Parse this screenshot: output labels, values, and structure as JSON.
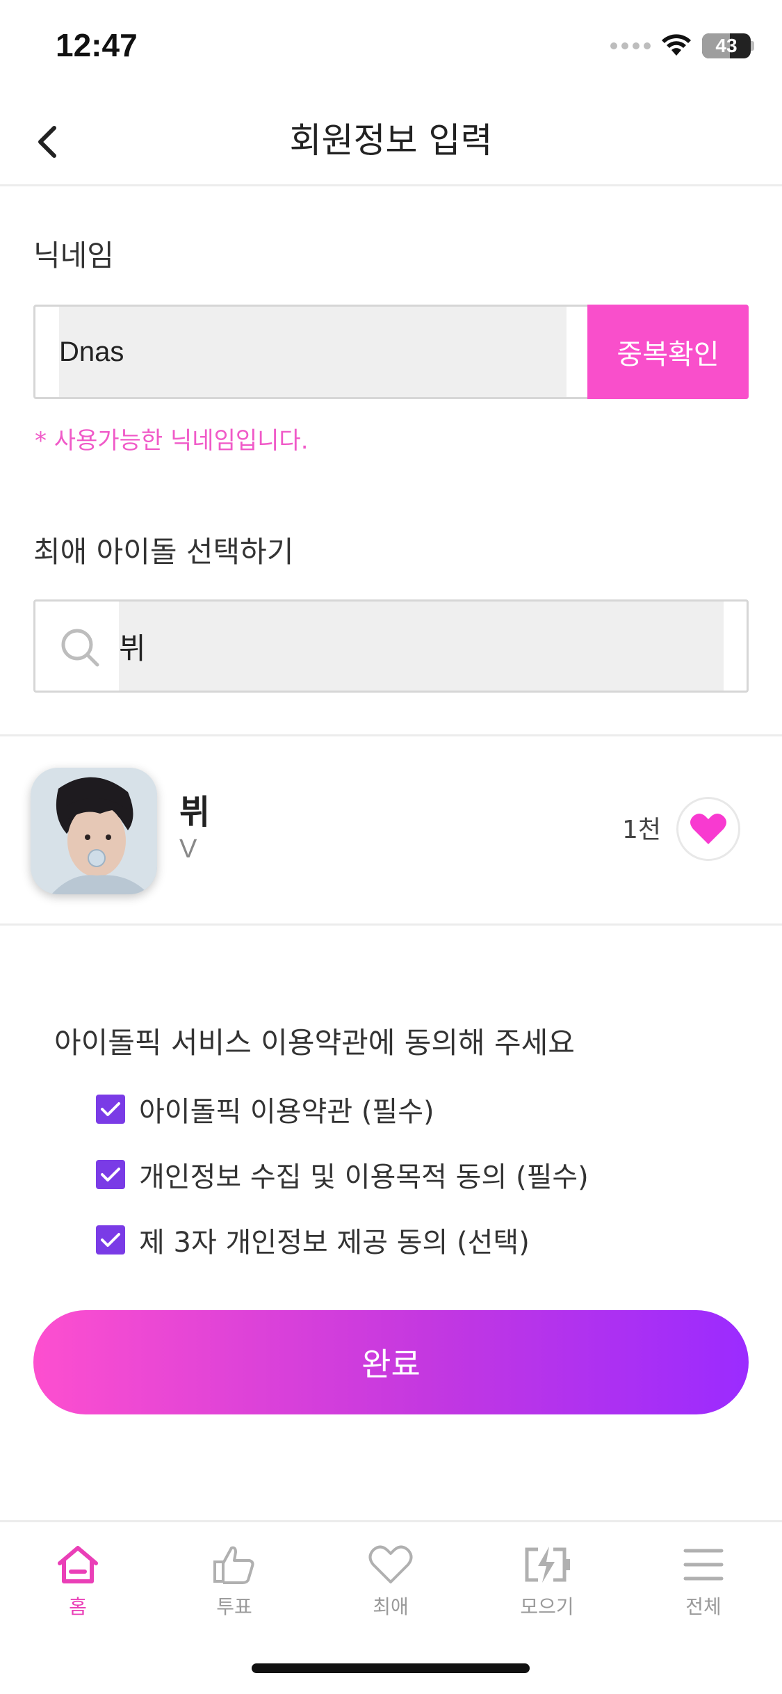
{
  "status": {
    "time": "12:47",
    "battery": "43",
    "battery_level_percent": 43
  },
  "header": {
    "title": "회원정보 입력"
  },
  "nickname": {
    "label": "닉네임",
    "value": "Dnas",
    "check_button": "중복확인",
    "message": "* 사용가능한 닉네임입니다."
  },
  "idol_select": {
    "label": "최애 아이돌 선택하기",
    "search_value": "뷔"
  },
  "idol_result": {
    "name": "뷔",
    "sub": "V",
    "count": "1천"
  },
  "terms": {
    "title": "아이돌픽 서비스 이용약관에 동의해 주세요",
    "items": [
      {
        "label": "아이돌픽 이용약관 (필수)",
        "checked": true
      },
      {
        "label": "개인정보 수집 및 이용목적 동의 (필수)",
        "checked": true
      },
      {
        "label": "제 3자 개인정보 제공 동의 (선택)",
        "checked": true
      }
    ]
  },
  "done_button": "완료",
  "colors": {
    "accent_pink": "#f94fcb",
    "checkbox_purple": "#7a3be6",
    "gradient_end": "#9b2bff"
  },
  "bottom_nav": {
    "items": [
      {
        "label": "홈",
        "icon": "home-icon",
        "active": true
      },
      {
        "label": "투표",
        "icon": "thumbs-up-icon",
        "active": false
      },
      {
        "label": "최애",
        "icon": "heart-outline-icon",
        "active": false
      },
      {
        "label": "모으기",
        "icon": "charge-icon",
        "active": false
      },
      {
        "label": "전체",
        "icon": "menu-icon",
        "active": false
      }
    ]
  }
}
